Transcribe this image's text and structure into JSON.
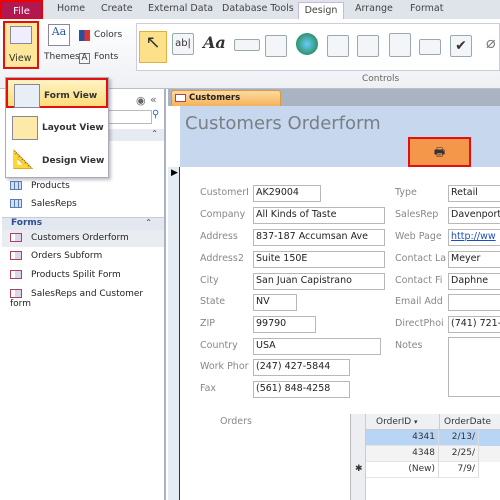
{
  "ribbon": {
    "tabs": [
      "File",
      "Home",
      "Create",
      "External Data",
      "Database Tools",
      "Design",
      "Arrange",
      "Format"
    ],
    "active_tab": "Design",
    "view_label": "View",
    "themes_label": "Themes",
    "colors_label": "Colors",
    "fonts_label": "Fonts",
    "controls_group_label": "Controls"
  },
  "view_menu": {
    "items": [
      "Form View",
      "Layout View",
      "Design View"
    ],
    "highlighted": "Form View"
  },
  "nav": {
    "tables": [
      "Products",
      "SalesReps"
    ],
    "forms_header": "Forms",
    "forms": [
      "Customers Orderform",
      "Orders Subform",
      "Products Spilit Form",
      "SalesReps and Customer form"
    ],
    "selected_form": "Customers Orderform"
  },
  "document": {
    "tab_label": "Customers Orderform",
    "title": "Customers Orderform",
    "accent_color": "#f4974a",
    "left_fields": [
      {
        "label": "CustomerI",
        "value": "AK29004"
      },
      {
        "label": "Company",
        "value": "All Kinds of Taste"
      },
      {
        "label": "Address",
        "value": "837-187 Accumsan Ave"
      },
      {
        "label": "Address2",
        "value": "Suite 150E"
      },
      {
        "label": "City",
        "value": "San Juan Capistrano"
      },
      {
        "label": "State",
        "value": "NV"
      },
      {
        "label": "ZIP",
        "value": "99790"
      },
      {
        "label": "Country",
        "value": "USA"
      },
      {
        "label": "Work Phor",
        "value": "(247) 427-5844"
      },
      {
        "label": "Fax",
        "value": "(561) 848-4258"
      }
    ],
    "right_fields": [
      {
        "label": "Type",
        "value": "Retail"
      },
      {
        "label": "SalesRep",
        "value": "Davenport"
      },
      {
        "label": "Web Page",
        "value": "http://ww"
      },
      {
        "label": "Contact La",
        "value": "Meyer"
      },
      {
        "label": "Contact Fi",
        "value": "Daphne"
      },
      {
        "label": "Email Add",
        "value": ""
      },
      {
        "label": "DirectPhoi",
        "value": "(741) 721-7"
      },
      {
        "label": "Notes",
        "value": ""
      }
    ],
    "orders_label": "Orders",
    "orders": {
      "columns": [
        "OrderID",
        "OrderDate"
      ],
      "rows": [
        [
          "4341",
          "2/13/"
        ],
        [
          "4348",
          "2/25/"
        ],
        [
          "(New)",
          "7/9/"
        ]
      ]
    }
  }
}
